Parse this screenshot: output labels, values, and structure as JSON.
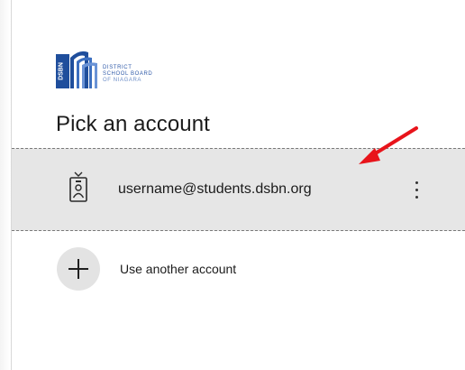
{
  "logo": {
    "mark_text": "DSBN",
    "lines": [
      "DISTRICT",
      "SCHOOL BOARD",
      "OF NIAGARA"
    ],
    "brand_color": "#2f5aa8"
  },
  "page": {
    "title": "Pick an account"
  },
  "accounts": [
    {
      "email": "username@students.dsbn.org",
      "icon": "badge-icon",
      "selected": true
    }
  ],
  "other_account": {
    "label": "Use another account",
    "icon": "plus-icon"
  },
  "annotation": {
    "icon": "red-arrow",
    "color": "#e8141b"
  }
}
